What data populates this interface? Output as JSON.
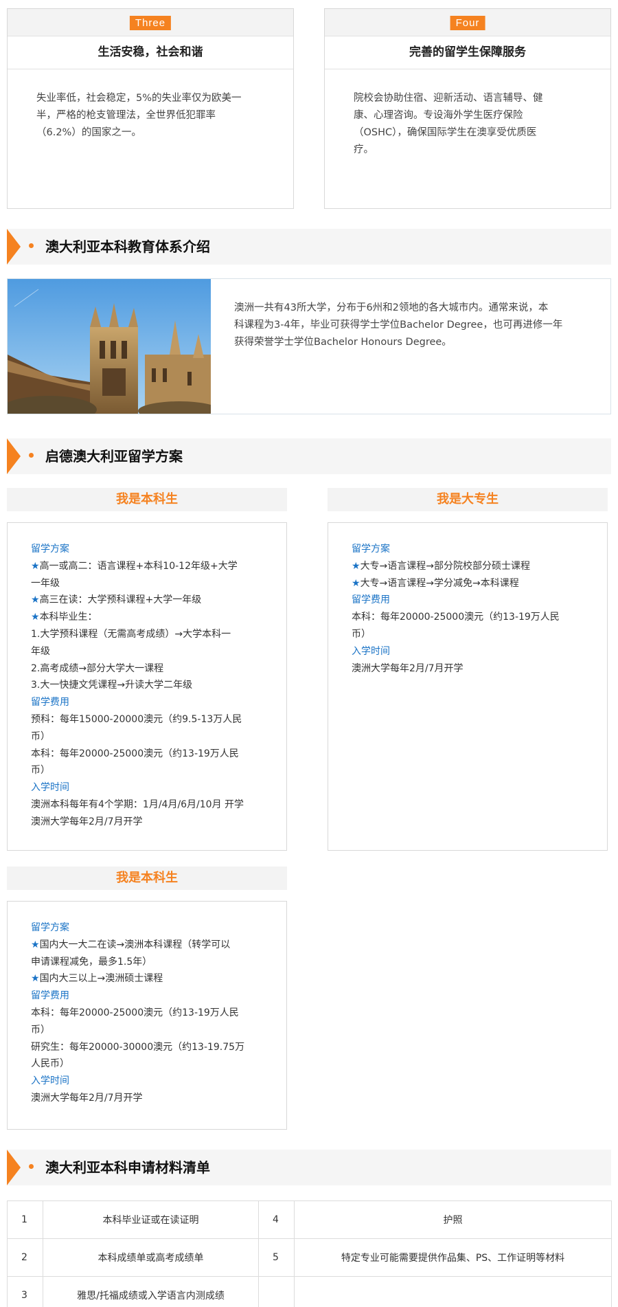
{
  "cards": [
    {
      "badge": "Three",
      "title": "生活安稳，社会和谐",
      "lines": [
        "失业率低，社会稳定，5%的失业率仅为欧美一",
        "半，严格的枪支管理法，全世界低犯罪率",
        "（6.2%）的国家之一。"
      ]
    },
    {
      "badge": "Four",
      "title": "完善的留学生保障服务",
      "lines": [
        "院校会协助住宿、迎新活动、语言辅导、健",
        "康、心理咨询。专设海外学生医疗保险",
        "（OSHC），确保国际学生在澳享受优质医",
        "疗。"
      ]
    }
  ],
  "sections": {
    "intro_title": "澳大利亚本科教育体系介绍",
    "plans_title": "启德澳大利亚留学方案",
    "materials_title": "澳大利亚本科申请材料清单"
  },
  "intro": {
    "image_icon": "cathedral-photo",
    "lines": [
      "澳洲一共有43所大学，分布于6州和2领地的各大城市内。通常来说，本",
      "科课程为3-4年，毕业可获得学士学位Bachelor Degree，也可再进修一年",
      "获得荣誉学士学位Bachelor Honours Degree。"
    ]
  },
  "plans": {
    "plan1": {
      "header": "我是本科生",
      "lines": [
        {
          "kind": "label",
          "text": "留学方案"
        },
        {
          "kind": "star",
          "star": "★",
          "text": "高一或高二：语言课程+本科10-12年级+大学"
        },
        {
          "kind": "text",
          "text": "一年级"
        },
        {
          "kind": "star",
          "star": "★",
          "text": "高三在读：大学预科课程+大学一年级"
        },
        {
          "kind": "star",
          "star": "★",
          "text": "本科毕业生："
        },
        {
          "kind": "text",
          "text": "1.大学预科课程（无需高考成绩）→大学本科一"
        },
        {
          "kind": "text",
          "text": "年级"
        },
        {
          "kind": "text",
          "text": "2.高考成绩→部分大学大一课程"
        },
        {
          "kind": "text",
          "text": "3.大一快捷文凭课程→升读大学二年级"
        },
        {
          "kind": "label",
          "text": "留学费用"
        },
        {
          "kind": "text",
          "text": "预科：每年15000-20000澳元（约9.5-13万人民"
        },
        {
          "kind": "text",
          "text": "币）"
        },
        {
          "kind": "text",
          "text": "本科：每年20000-25000澳元（约13-19万人民"
        },
        {
          "kind": "text",
          "text": "币）"
        },
        {
          "kind": "label",
          "text": "入学时间"
        },
        {
          "kind": "text",
          "text": "澳洲本科每年有4个学期：1月/4月/6月/10月 开学"
        },
        {
          "kind": "text",
          "text": "澳洲大学每年2月/7月开学"
        }
      ]
    },
    "plan2": {
      "header": "我是大专生",
      "lines": [
        {
          "kind": "label",
          "text": "留学方案"
        },
        {
          "kind": "star",
          "star": "★",
          "text": "大专→语言课程→部分院校部分硕士课程"
        },
        {
          "kind": "star",
          "star": "★",
          "text": "大专→语言课程→学分减免→本科课程"
        },
        {
          "kind": "label",
          "text": "留学费用"
        },
        {
          "kind": "text",
          "text": "本科：每年20000-25000澳元（约13-19万人民"
        },
        {
          "kind": "text",
          "text": "币）"
        },
        {
          "kind": "label",
          "text": "入学时间"
        },
        {
          "kind": "text",
          "text": "澳洲大学每年2月/7月开学"
        }
      ]
    },
    "plan3": {
      "header": "我是本科生",
      "lines": [
        {
          "kind": "label",
          "text": "留学方案"
        },
        {
          "kind": "star",
          "star": "★",
          "text": "国内大一大二在读→澳洲本科课程（转学可以"
        },
        {
          "kind": "text",
          "text": "申请课程减免，最多1.5年）"
        },
        {
          "kind": "star",
          "star": "★",
          "text": "国内大三以上→澳洲硕士课程"
        },
        {
          "kind": "label",
          "text": "留学费用"
        },
        {
          "kind": "text",
          "text": "本科：每年20000-25000澳元（约13-19万人民"
        },
        {
          "kind": "text",
          "text": "币）"
        },
        {
          "kind": "text",
          "text": "研究生：每年20000-30000澳元（约13-19.75万"
        },
        {
          "kind": "text",
          "text": "人民币）"
        },
        {
          "kind": "label",
          "text": "入学时间"
        },
        {
          "kind": "text",
          "text": "澳洲大学每年2月/7月开学"
        }
      ]
    }
  },
  "materials": {
    "rows": [
      {
        "n1": "1",
        "t1": "本科毕业证或在读证明",
        "n2": "4",
        "t2": "护照"
      },
      {
        "n1": "2",
        "t1": "本科成绩单或高考成绩单",
        "n2": "5",
        "t2": "特定专业可能需要提供作品集、PS、工作证明等材料"
      },
      {
        "n1": "3",
        "t1": "雅思/托福成绩或入学语言内测成绩",
        "n2": "",
        "t2": ""
      }
    ]
  },
  "colors": {
    "accent": "#f58220",
    "label_blue": "#1a73c6"
  }
}
